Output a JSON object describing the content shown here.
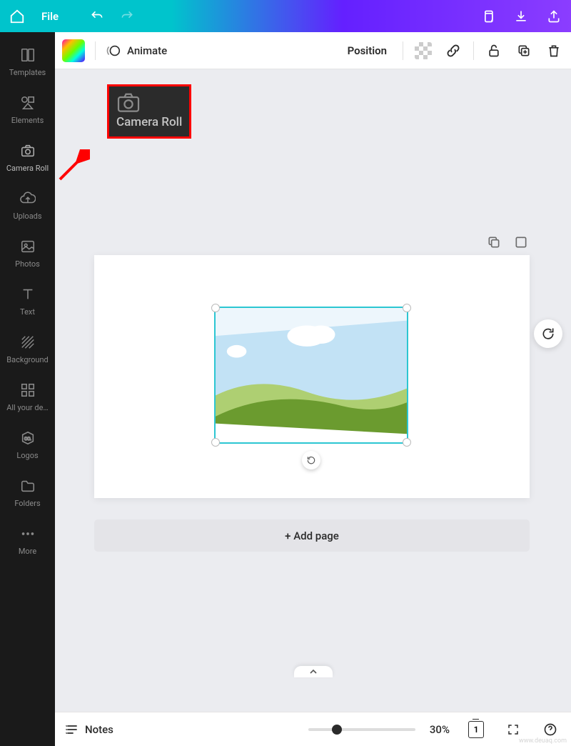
{
  "topbar": {
    "file_label": "File"
  },
  "sidebar": {
    "items": [
      {
        "label": "Templates",
        "icon": "templates-icon"
      },
      {
        "label": "Elements",
        "icon": "elements-icon"
      },
      {
        "label": "Camera Roll",
        "icon": "camera-icon"
      },
      {
        "label": "Uploads",
        "icon": "uploads-icon"
      },
      {
        "label": "Photos",
        "icon": "photos-icon"
      },
      {
        "label": "Text",
        "icon": "text-icon"
      },
      {
        "label": "Background",
        "icon": "background-icon"
      },
      {
        "label": "All your de…",
        "icon": "designs-icon"
      },
      {
        "label": "Logos",
        "icon": "logos-icon"
      },
      {
        "label": "Folders",
        "icon": "folders-icon"
      },
      {
        "label": "More",
        "icon": "more-icon"
      }
    ]
  },
  "context_bar": {
    "animate_label": "Animate",
    "position_label": "Position"
  },
  "callout": {
    "label": "Camera Roll"
  },
  "canvas": {
    "add_page_label": "+ Add page"
  },
  "bottom": {
    "notes_label": "Notes",
    "zoom": "30%",
    "page_count": "1"
  },
  "watermark": "www.deuaq.com"
}
